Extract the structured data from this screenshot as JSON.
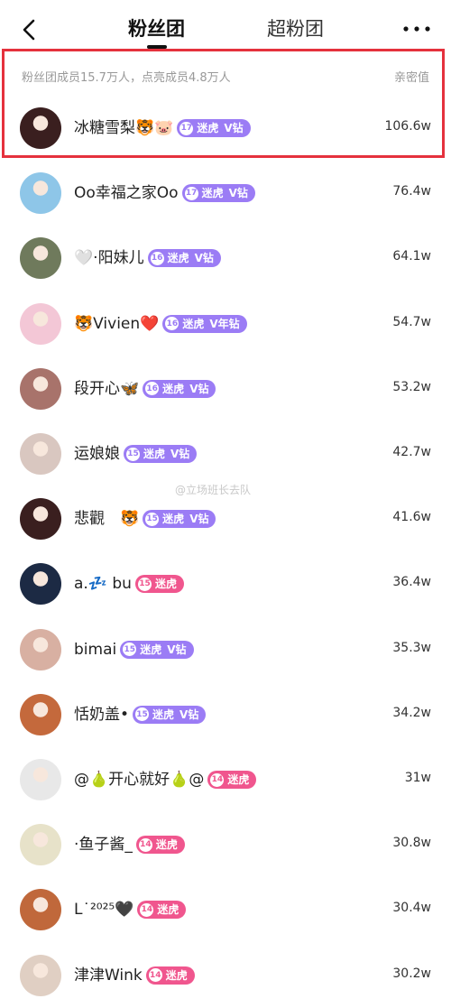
{
  "header": {
    "tab_active": "粉丝团",
    "tab_inactive": "超粉团",
    "more": "•••"
  },
  "summary": {
    "text": "粉丝团成员15.7万人，点亮成员4.8万人",
    "closeness_label": "亲密值"
  },
  "watermark": "@立场班长去队",
  "members": [
    {
      "name": "冰糖雪梨🐯🐷",
      "level": "17",
      "tag": "迷虎",
      "vip": "V钻",
      "color": "purple",
      "value": "106.6w"
    },
    {
      "name": "Oo幸福之家Oo",
      "level": "17",
      "tag": "迷虎",
      "vip": "V钻",
      "color": "purple",
      "value": "76.4w"
    },
    {
      "name": "🤍·阳妹儿",
      "level": "16",
      "tag": "迷虎",
      "vip": "V钻",
      "color": "purple",
      "value": "64.1w"
    },
    {
      "name": "🐯Vivien❤️",
      "level": "16",
      "tag": "迷虎",
      "vip": "V年钻",
      "color": "purple",
      "value": "54.7w"
    },
    {
      "name": "段开心🦋",
      "level": "16",
      "tag": "迷虎",
      "vip": "V钻",
      "color": "purple",
      "value": "53.2w"
    },
    {
      "name": "运娘娘",
      "level": "15",
      "tag": "迷虎",
      "vip": "V钻",
      "color": "purple",
      "value": "42.7w"
    },
    {
      "name": "悲觀　🐯",
      "level": "15",
      "tag": "迷虎",
      "vip": "V钻",
      "color": "purple",
      "value": "41.6w"
    },
    {
      "name": "a.💤 bu",
      "level": "15",
      "tag": "迷虎",
      "vip": "",
      "color": "pink",
      "value": "36.4w"
    },
    {
      "name": "bimai",
      "level": "15",
      "tag": "迷虎",
      "vip": "V钻",
      "color": "purple",
      "value": "35.3w"
    },
    {
      "name": "恬奶盖•",
      "level": "15",
      "tag": "迷虎",
      "vip": "V钻",
      "color": "purple",
      "value": "34.2w"
    },
    {
      "name": "@🍐开心就好🍐@",
      "level": "14",
      "tag": "迷虎",
      "vip": "",
      "color": "pink",
      "value": "31w"
    },
    {
      "name": "·鱼子酱_",
      "level": "14",
      "tag": "迷虎",
      "vip": "",
      "color": "pink",
      "value": "30.8w"
    },
    {
      "name": "L˙²⁰²⁵🖤",
      "level": "14",
      "tag": "迷虎",
      "vip": "",
      "color": "pink",
      "value": "30.4w"
    },
    {
      "name": "津津Wink",
      "level": "14",
      "tag": "迷虎",
      "vip": "",
      "color": "pink",
      "value": "30.2w"
    }
  ],
  "avatar_colors": [
    "#3a1f1f",
    "#8ec6e8",
    "#6f7a5c",
    "#f3c7d6",
    "#a8736b",
    "#d9c7c0",
    "#3a1f1f",
    "#1c2a44",
    "#d8b0a2",
    "#c4693c",
    "#e8e8e8",
    "#e7e2c9",
    "#c0683b",
    "#e0cfc3"
  ]
}
